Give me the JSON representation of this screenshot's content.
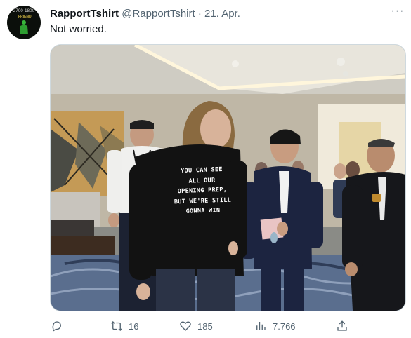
{
  "tweet": {
    "display_name": "RapportTshirt",
    "handle": "@RapportTshirt",
    "separator": " · ",
    "date": "21. Apr.",
    "text": "Not worried.",
    "more_label": "···",
    "avatar": {
      "top_text": "2700-1800",
      "badge_text": "FRIEND"
    }
  },
  "media": {
    "shirt_lines": [
      "YOU CAN SEE",
      "ALL OUR",
      "OPENING PREP,",
      "BUT WE'RE STILL",
      "GONNA WIN"
    ],
    "card_text": ""
  },
  "actions": {
    "reply": {
      "icon": "reply-icon",
      "count": ""
    },
    "retweet": {
      "icon": "retweet-icon",
      "count": "16"
    },
    "like": {
      "icon": "heart-icon",
      "count": "185"
    },
    "views": {
      "icon": "views-icon",
      "count": "7.766"
    },
    "share": {
      "icon": "share-icon",
      "count": ""
    }
  },
  "colors": {
    "text_primary": "#0f1419",
    "text_secondary": "#536471",
    "border": "#cfd9de"
  }
}
